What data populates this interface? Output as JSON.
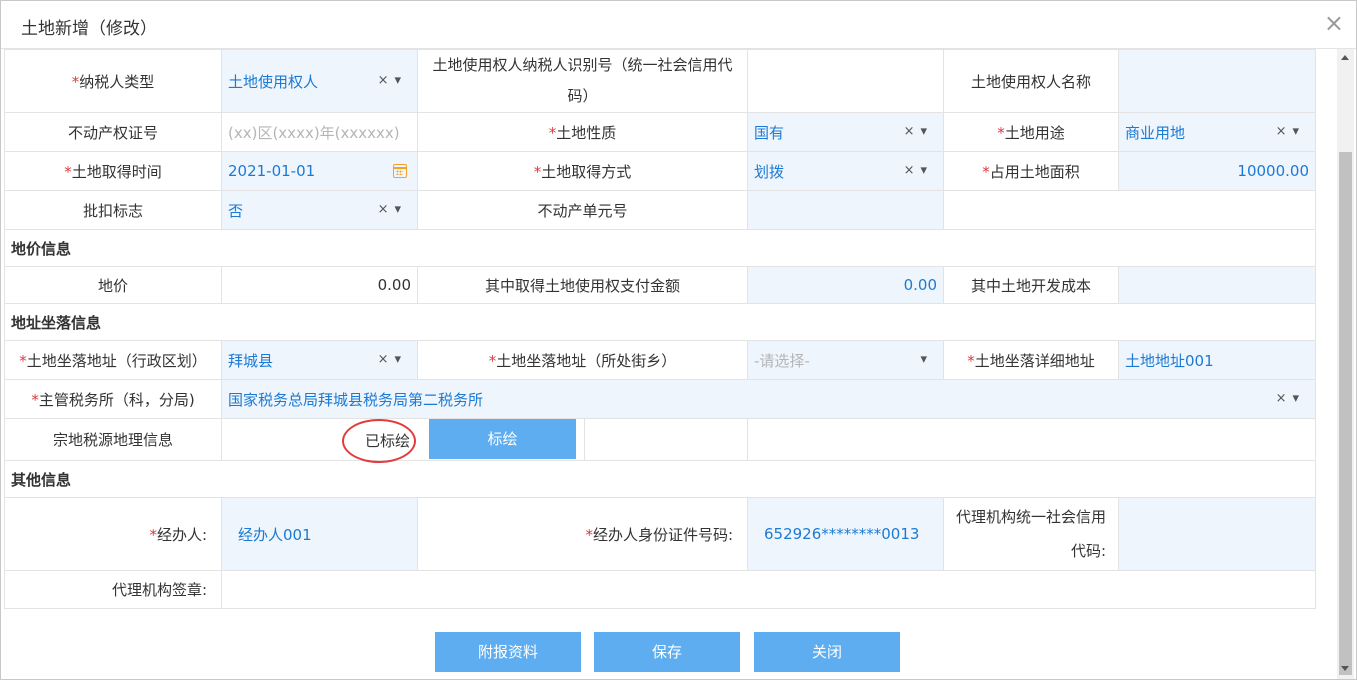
{
  "dialog": {
    "title": "土地新增（修改）",
    "close_icon": "×"
  },
  "row1": {
    "taxpayer_type_label": "纳税人类型",
    "taxpayer_type_value": "土地使用权人",
    "taxid_label": "土地使用权人纳税人识别号（统一社会信用代码）",
    "name_label": "土地使用权人名称"
  },
  "row2": {
    "cert_label": "不动产权证号",
    "cert_placeholder": "(xx)区(xxxx)年(xxxxxx)",
    "nature_label": "土地性质",
    "nature_value": "国有",
    "use_label": "土地用途",
    "use_value": "商业用地"
  },
  "row3": {
    "time_label": "土地取得时间",
    "time_value": "2021-01-01",
    "way_label": "土地取得方式",
    "way_value": "划拨",
    "area_label": "占用土地面积",
    "area_value": "10000.00"
  },
  "row4": {
    "flag_label": "批扣标志",
    "flag_value": "否",
    "unit_label": "不动产单元号"
  },
  "price_section": {
    "title": "地价信息",
    "price_label": "地价",
    "price_value": "0.00",
    "pay_label": "其中取得土地使用权支付金额",
    "pay_value": "0.00",
    "dev_label": "其中土地开发成本"
  },
  "address_section": {
    "title": "地址坐落信息",
    "region_label": "土地坐落地址（行政区划）",
    "region_value": "拜城县",
    "street_label": "土地坐落地址（所处街乡）",
    "street_placeholder": "-请选择-",
    "detail_label": "土地坐落详细地址",
    "detail_value": "土地地址001",
    "office_label": "主管税务所（科，分局)",
    "office_value": "国家税务总局拜城县税务局第二税务所",
    "geo_label": "宗地税源地理信息",
    "geo_status": "已标绘",
    "geo_button": "标绘"
  },
  "other_section": {
    "title": "其他信息",
    "handler_label": "经办人:",
    "handler_value": "经办人001",
    "idno_label": "经办人身份证件号码:",
    "idno_value": "652926********0013",
    "agency_label": "代理机构统一社会信用代码:",
    "seal_label": "代理机构签章:"
  },
  "footer": {
    "attach": "附报资料",
    "save": "保存",
    "close": "关闭"
  },
  "colors": {
    "accent": "#5dadf0",
    "required": "#e0393e",
    "input_bg": "#eef5fd",
    "input_text": "#1c7ad3"
  }
}
